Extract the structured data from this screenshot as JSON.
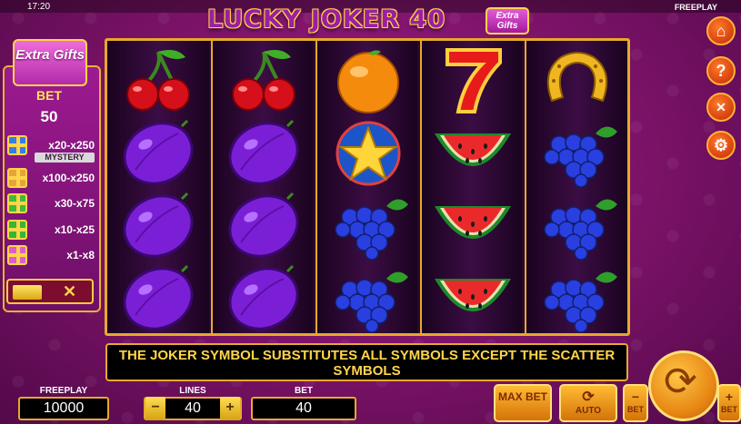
{
  "status": {
    "time": "17:20",
    "mode": "FREEPLAY"
  },
  "logo": {
    "title": "LUCKY JOKER 40",
    "badge": "Extra Gifts"
  },
  "side_panel": {
    "title": "Extra Gifts",
    "bet_label": "BET",
    "bet_value": "50",
    "gifts": [
      {
        "color": "#3b7be8",
        "text": "x20-x250",
        "tag": "MYSTERY"
      },
      {
        "color": "#e8a43b",
        "text": "x100-x250"
      },
      {
        "color": "#3fb840",
        "text": "x30-x75"
      },
      {
        "color": "#38b534",
        "text": "x10-x25"
      },
      {
        "color": "#e05bd0",
        "text": "x1-x8"
      }
    ],
    "toggle_symbol": "✕"
  },
  "reels": [
    [
      "cherry",
      "plum",
      "plum",
      "plum"
    ],
    [
      "cherry",
      "plum",
      "plum",
      "plum"
    ],
    [
      "orange",
      "star",
      "grapes",
      "grapes"
    ],
    [
      "seven",
      "watermelon",
      "watermelon",
      "watermelon"
    ],
    [
      "horseshoe",
      "grapes",
      "grapes",
      "grapes"
    ]
  ],
  "message": "THE JOKER SYMBOL SUBSTITUTES ALL SYMBOLS EXCEPT THE SCATTER SYMBOLS",
  "right_buttons": [
    {
      "name": "home-button",
      "icon": "home-icon",
      "glyph": "⌂"
    },
    {
      "name": "help-button",
      "icon": "question-icon",
      "glyph": "?"
    },
    {
      "name": "sound-button",
      "icon": "speaker-muted-icon",
      "glyph": "✕"
    },
    {
      "name": "settings-button",
      "icon": "gear-icon",
      "glyph": "⚙"
    }
  ],
  "bottom": {
    "freeplay_label": "FREEPLAY",
    "freeplay_value": "10000",
    "lines_label": "LINES",
    "lines_value": "40",
    "lines_minus": "−",
    "lines_plus": "+",
    "bet_label": "BET",
    "bet_value": "40",
    "max_bet": "MAX BET",
    "auto": "AUTO",
    "bet_minus_label": "BET",
    "bet_plus_label": "BET",
    "bet_minus": "−",
    "bet_plus": "+"
  },
  "colors": {
    "accent_gold": "#e7a92b",
    "background": "#7a1266",
    "button_orange": "#d6410e"
  }
}
